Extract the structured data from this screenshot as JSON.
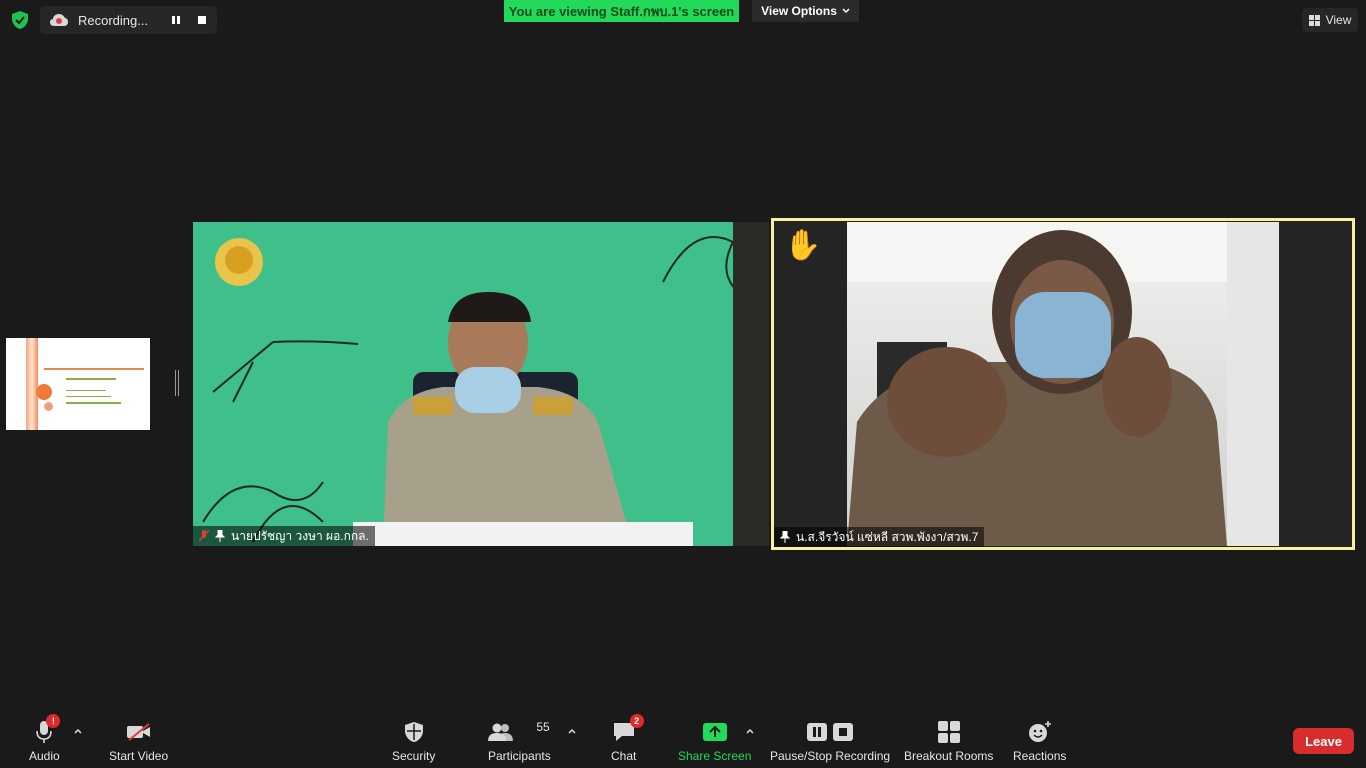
{
  "topbar": {
    "recording_label": "Recording...",
    "viewing_prefix": "You are viewing ",
    "viewing_name": "Staff.กพบ.1's screen",
    "view_options_label": "View Options",
    "view_label": "View"
  },
  "participants": {
    "left_name": "นายปรัชญา วงษา ผอ.กกล.",
    "right_name": "น.ส.จีรวัจน์ แซ่หลี สวพ.พังงา/สวพ.7"
  },
  "toolbar": {
    "audio_label": "Audio",
    "audio_badge": "!",
    "video_label": "Start Video",
    "security_label": "Security",
    "participants_label": "Participants",
    "participants_count": "55",
    "chat_label": "Chat",
    "chat_badge": "2",
    "share_label": "Share Screen",
    "recording_label": "Pause/Stop Recording",
    "breakout_label": "Breakout Rooms",
    "reactions_label": "Reactions",
    "leave_label": "Leave"
  },
  "colors": {
    "background": "#1a1a1a",
    "share_green": "#23d959",
    "leave_red": "#d92d2d",
    "active_speaker_border": "#f4f2a0"
  }
}
